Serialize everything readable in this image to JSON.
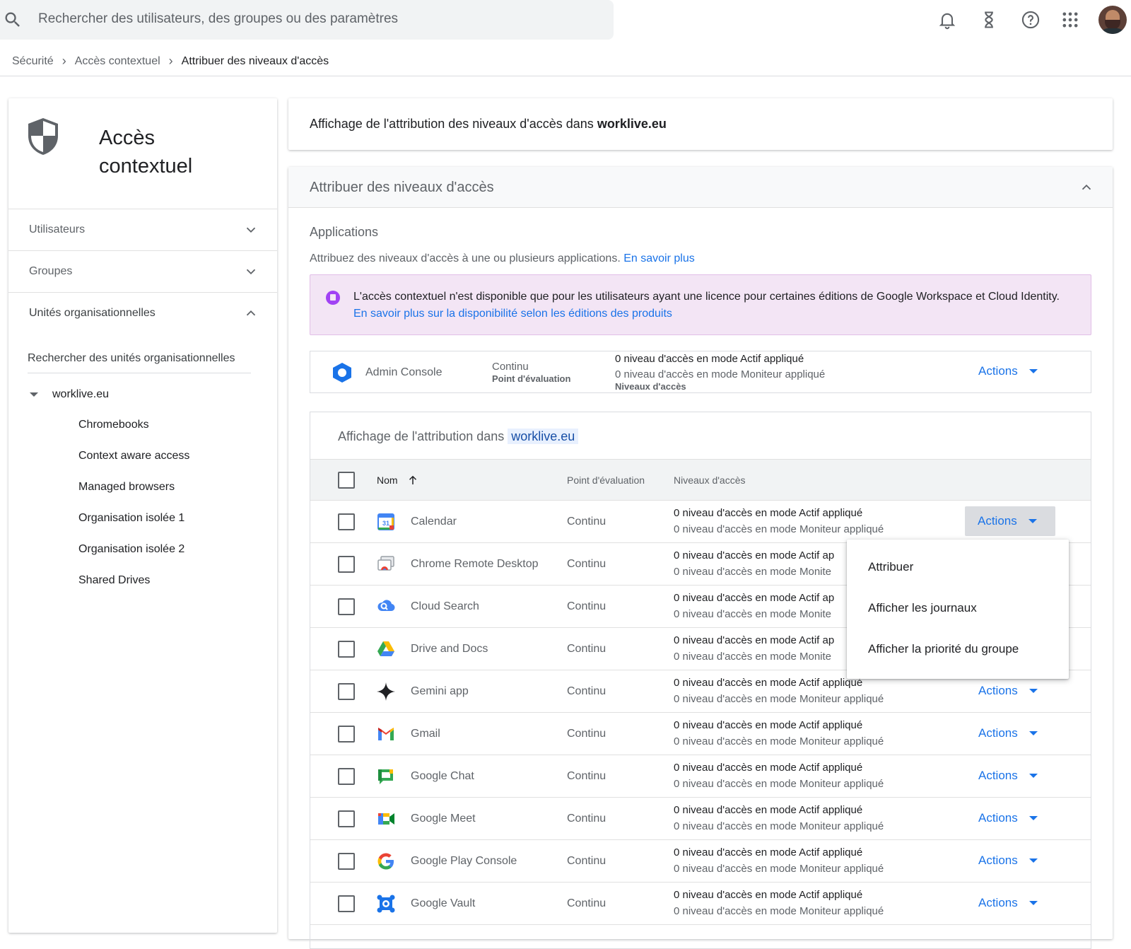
{
  "search": {
    "placeholder": "Rechercher des utilisateurs, des groupes ou des paramètres"
  },
  "header_icons": [
    "bell-icon",
    "hourglass-icon",
    "help-icon",
    "apps-grid-icon"
  ],
  "breadcrumb": [
    "Sécurité",
    "Accès contextuel",
    "Attribuer des niveaux d'accès"
  ],
  "left_panel": {
    "title": "Accès\ncontextuel",
    "sections": [
      "Utilisateurs",
      "Groupes",
      "Unités organisationnelles"
    ],
    "ou_search": "Rechercher des unités organisationnelles",
    "root_ou": "worklive.eu",
    "ous": [
      "Chromebooks",
      "Context aware access",
      "Managed browsers",
      "Organisation isolée 1",
      "Organisation isolée 2",
      "Shared Drives"
    ]
  },
  "summary": {
    "prefix": "Affichage de l'attribution des niveaux d'accès dans ",
    "domain": "worklive.eu"
  },
  "assign": {
    "title": "Attribuer des niveaux d'accès",
    "apps_heading": "Applications",
    "apps_desc": "Attribuez des niveaux d'accès à une ou plusieurs applications.",
    "learn_more": "En savoir plus",
    "banner_text": "L'accès contextuel n'est disponible que pour les utilisateurs ayant une licence pour certaines éditions de Google Workspace et Cloud Identity.",
    "banner_link": "En savoir plus sur la disponibilité selon les éditions des produits"
  },
  "admin_row": {
    "name": "Admin Console",
    "eval": "Continu",
    "eval_label": "Point d'évaluation",
    "line1": "0 niveau d'accès en mode Actif appliqué",
    "line2": "0 niveau d'accès en mode Moniteur appliqué",
    "levels_label": "Niveaux d'accès",
    "actions": "Actions"
  },
  "table": {
    "title_prefix": "Affichage de l'attribution dans",
    "domain": "worklive.eu",
    "headers": {
      "name": "Nom",
      "eval": "Point d'évaluation",
      "levels": "Niveaux d'accès"
    },
    "rows": [
      {
        "name": "Calendar",
        "icon": "calendar-icon",
        "eval": "Continu",
        "l1": "0 niveau d'accès en mode Actif appliqué",
        "l2": "0 niveau d'accès en mode Moniteur appliqué",
        "actions": "Actions"
      },
      {
        "name": "Chrome Remote Desktop",
        "icon": "chrome-remote-desktop-icon",
        "eval": "Continu",
        "l1": "0 niveau d'accès en mode Actif ap",
        "l2": "0 niveau d'accès en mode Monite",
        "actions": ""
      },
      {
        "name": "Cloud Search",
        "icon": "cloud-search-icon",
        "eval": "Continu",
        "l1": "0 niveau d'accès en mode Actif ap",
        "l2": "0 niveau d'accès en mode Monite",
        "actions": ""
      },
      {
        "name": "Drive and Docs",
        "icon": "drive-icon",
        "eval": "Continu",
        "l1": "0 niveau d'accès en mode Actif ap",
        "l2": "0 niveau d'accès en mode Monite",
        "actions": ""
      },
      {
        "name": "Gemini app",
        "icon": "gemini-icon",
        "eval": "Continu",
        "l1": "0 niveau d'accès en mode Actif appliqué",
        "l2": "0 niveau d'accès en mode Moniteur appliqué",
        "actions": "Actions"
      },
      {
        "name": "Gmail",
        "icon": "gmail-icon",
        "eval": "Continu",
        "l1": "0 niveau d'accès en mode Actif appliqué",
        "l2": "0 niveau d'accès en mode Moniteur appliqué",
        "actions": "Actions"
      },
      {
        "name": "Google Chat",
        "icon": "google-chat-icon",
        "eval": "Continu",
        "l1": "0 niveau d'accès en mode Actif appliqué",
        "l2": "0 niveau d'accès en mode Moniteur appliqué",
        "actions": "Actions"
      },
      {
        "name": "Google Meet",
        "icon": "google-meet-icon",
        "eval": "Continu",
        "l1": "0 niveau d'accès en mode Actif appliqué",
        "l2": "0 niveau d'accès en mode Moniteur appliqué",
        "actions": "Actions"
      },
      {
        "name": "Google Play Console",
        "icon": "google-g-icon",
        "eval": "Continu",
        "l1": "0 niveau d'accès en mode Actif appliqué",
        "l2": "0 niveau d'accès en mode Moniteur appliqué",
        "actions": "Actions"
      },
      {
        "name": "Google Vault",
        "icon": "google-vault-icon",
        "eval": "Continu",
        "l1": "0 niveau d'accès en mode Actif appliqué",
        "l2": "0 niveau d'accès en mode Moniteur appliqué",
        "actions": "Actions"
      }
    ]
  },
  "menu": {
    "items": [
      "Attribuer",
      "Afficher les journaux",
      "Afficher la priorité du groupe"
    ]
  },
  "colors": {
    "accent": "#1a73e8",
    "banner_bg": "#f3e5f5",
    "banner_icon": "#a142f4"
  }
}
